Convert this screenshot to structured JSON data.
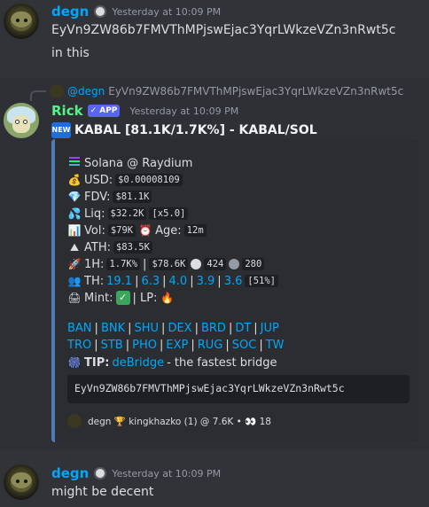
{
  "messages": [
    {
      "user": "degn",
      "timestamp": "Yesterday at 10:09 PM",
      "lines": [
        "EyVn9ZW86b7FMVThMPjswEjac3YqrLWkzeVZn3nRwt5c",
        "in this"
      ]
    },
    {
      "reply": {
        "user": "@degn",
        "text": "EyVn9ZW86b7FMVThMPjswEjac3YqrLWkzeVZn3nRwt5c"
      },
      "user": "Rick",
      "badge": "APP",
      "timestamp": "Yesterday at 10:09 PM",
      "title_badge": "NEW",
      "title": "KABAL [81.1K/1.7K%] - KABAL/SOL",
      "embed": {
        "chain": "Solana @ Raydium",
        "usd_label": "USD:",
        "usd": "$0.00008109",
        "fdv_label": "FDV:",
        "fdv": "$81.1K",
        "liq_label": "Liq:",
        "liq": "$32.2K",
        "liq_mult": "[x5.0]",
        "vol_label": "Vol:",
        "vol": "$79K",
        "age_label": "Age:",
        "age": "12m",
        "ath_label": "ATH:",
        "ath": "$83.5K",
        "h1_label": "1H:",
        "h1_change": "1.7K%",
        "h1_sep": "|",
        "h1_vol": "$78.6K",
        "h1_buys": "424",
        "h1_sells": "280",
        "th_label": "TH:",
        "th_values": [
          "19.1",
          "6.3",
          "4.0",
          "3.9",
          "3.6"
        ],
        "th_total": "[51%]",
        "mint_label": "Mint:",
        "lp_label": "| LP:",
        "links_row1": [
          "BAN",
          "BNK",
          "SHU",
          "DEX",
          "BRD",
          "DT",
          "JUP"
        ],
        "links_row2": [
          "TRO",
          "STB",
          "PHO",
          "EXP",
          "RUG",
          "SOC",
          "TW"
        ],
        "tip_label": "TIP:",
        "tip_link": "deBridge",
        "tip_text": "- the fastest bridge",
        "contract": "EyVn9ZW86b7FMVThMPjswEjac3YqrLWkzeVZn3nRwt5c",
        "footer": "degn 🏆 kingkhazko (1) @ 7.6K • 👀 18"
      }
    },
    {
      "user": "degn",
      "timestamp": "Yesterday at 10:09 PM",
      "lines": [
        "might be decent"
      ]
    }
  ],
  "colors": {
    "background": "#313338",
    "embed_bg": "#2b2d31",
    "embed_border": "#4e7bb8",
    "degn_name": "#00a8fc",
    "rick_name": "#57f287",
    "link": "#00a8fc",
    "app_badge": "#5865f2"
  },
  "icons": {
    "solana": "solana-icon",
    "usd": "money-bag-icon",
    "fdv": "diamond-icon",
    "liq": "droplets-icon",
    "vol": "chart-icon",
    "age": "alarm-clock-icon",
    "ath": "mountain-icon",
    "h1": "rocket-icon",
    "th": "people-icon",
    "mint": "printer-icon",
    "mint_status": "check-mark-icon",
    "lp": "fire-icon",
    "tip": "tip-icon"
  }
}
